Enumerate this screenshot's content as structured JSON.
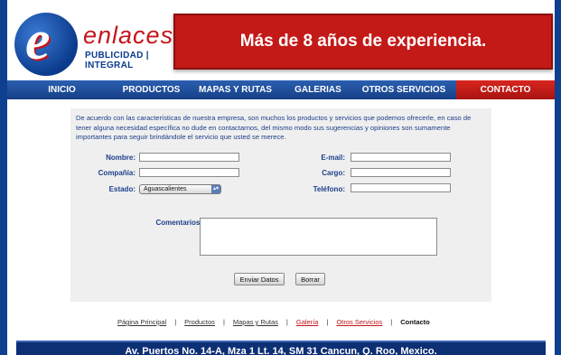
{
  "header": {
    "logo_letter": "e",
    "logo_word": "enlaces",
    "logo_tagline": "PUBLICIDAD | INTEGRAL",
    "banner_text": "Más de 8 años de experiencia.",
    "colors": {
      "brand_blue": "#0b3b8c",
      "brand_red": "#c3161c"
    }
  },
  "nav": {
    "items": [
      {
        "label": "INICIO"
      },
      {
        "label": "PRODUCTOS"
      },
      {
        "label": "MAPAS Y RUTAS"
      },
      {
        "label": "GALERIAS"
      },
      {
        "label": "OTROS SERVICIOS"
      },
      {
        "label": "CONTACTO",
        "active": true
      }
    ]
  },
  "form": {
    "intro": "De acuerdo con las características de nuestra empresa, son muchos los productos y servicios que podemos ofrecerle, en caso de tener alguna necesidad específica no dude en contactarnos, del mismo modo sus sugerencias y opiniones son sumamente importantes para seguir brindándole el servicio que usted se merece.",
    "nombre_label": "Nombre:",
    "nombre_value": "",
    "email_label": "E-mail:",
    "email_value": "",
    "compania_label": "Compañía:",
    "compania_value": "",
    "cargo_label": "Cargo:",
    "cargo_value": "",
    "estado_label": "Estado:",
    "estado_value": "Aguascalientes",
    "telefono_label": "Teléfono:",
    "telefono_value": "",
    "comentarios_label": "Comentarios:",
    "comentarios_value": "",
    "submit_label": "Enviar Datos",
    "reset_label": "Borrar"
  },
  "footer": {
    "links": [
      {
        "label": "Página Principal",
        "color": "#333333"
      },
      {
        "label": "Productos",
        "color": "#333333"
      },
      {
        "label": "Mapas y Rutas",
        "color": "#333333"
      },
      {
        "label": "Galería",
        "color": "#c3161c"
      },
      {
        "label": "Otros Servicios",
        "color": "#c3161c"
      }
    ],
    "current": "Contacto",
    "separator": "|",
    "address": "Av. Puertos No. 14-A, Mza 1 Lt. 14, SM 31  Cancun, Q. Roo, Mexico."
  }
}
